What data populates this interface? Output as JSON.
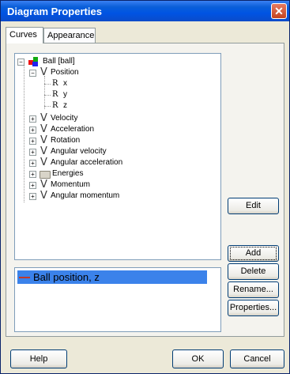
{
  "window": {
    "title": "Diagram Properties",
    "close_glyph": "✕"
  },
  "tabs": [
    {
      "label": "Curves",
      "active": true
    },
    {
      "label": "Appearance",
      "active": false
    }
  ],
  "tree": {
    "root": {
      "label": "Ball  [ball]",
      "expander": "−"
    },
    "position": {
      "label": "Position",
      "expander": "−",
      "icon": "V"
    },
    "coords": [
      {
        "label": "x",
        "icon": "R"
      },
      {
        "label": "y",
        "icon": "R"
      },
      {
        "label": "z",
        "icon": "R"
      }
    ],
    "items": [
      {
        "label": "Velocity",
        "icon": "V",
        "expander": "+"
      },
      {
        "label": "Acceleration",
        "icon": "V",
        "expander": "+"
      },
      {
        "label": "Rotation",
        "icon": "V",
        "expander": "+"
      },
      {
        "label": "Angular velocity",
        "icon": "V",
        "expander": "+"
      },
      {
        "label": "Angular acceleration",
        "icon": "V",
        "expander": "+"
      },
      {
        "label": "Energies",
        "icon": "folder",
        "expander": "+"
      },
      {
        "label": "Momentum",
        "icon": "V",
        "expander": "+"
      },
      {
        "label": "Angular momentum",
        "icon": "V",
        "expander": "+"
      }
    ]
  },
  "buttons": {
    "edit": "Edit",
    "add": "Add",
    "delete": "Delete",
    "rename": "Rename...",
    "properties": "Properties...",
    "help": "Help",
    "ok": "OK",
    "cancel": "Cancel"
  },
  "curves": [
    {
      "label": "Ball position,  z",
      "color": "#c0392b",
      "selected": true
    }
  ],
  "colors": {
    "selection": "#3b82ea",
    "titlebar": "#0054e3"
  }
}
